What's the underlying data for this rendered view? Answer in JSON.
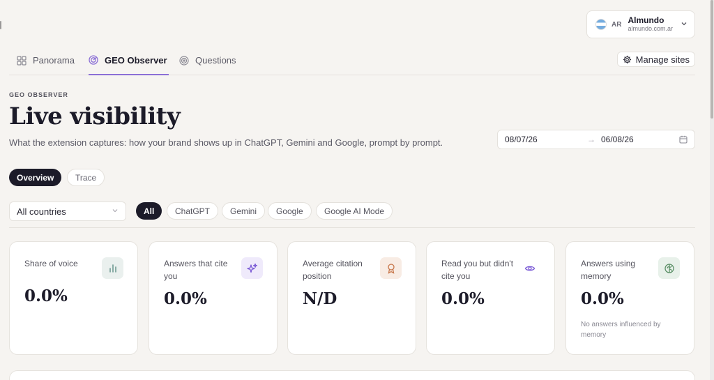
{
  "site": {
    "code": "AR",
    "name": "Almundo",
    "domain": "almundo.com.ar",
    "chevron_icon": "chevron-down-icon"
  },
  "nav": {
    "tabs": [
      {
        "label": "Panorama",
        "icon": "grid-icon",
        "active": false
      },
      {
        "label": "GEO Observer",
        "icon": "radar-icon",
        "active": true
      },
      {
        "label": "Questions",
        "icon": "target-icon",
        "active": false
      }
    ],
    "manage_sites": {
      "label": "Manage sites",
      "icon": "gear-icon"
    }
  },
  "header": {
    "eyebrow": "GEO OBSERVER",
    "title": "Live visibility",
    "subtitle": "What the extension captures: how your brand shows up in ChatGPT, Gemini and Google, prompt by prompt."
  },
  "date_range": {
    "start": "08/07/26",
    "arrow": "→",
    "end": "06/08/26",
    "icon": "calendar-icon"
  },
  "view_toggle": [
    {
      "label": "Overview",
      "active": true
    },
    {
      "label": "Trace",
      "active": false
    }
  ],
  "filters": {
    "country": {
      "value": "All countries"
    },
    "engines": [
      {
        "label": "All",
        "active": true
      },
      {
        "label": "ChatGPT",
        "active": false
      },
      {
        "label": "Gemini",
        "active": false
      },
      {
        "label": "Google",
        "active": false
      },
      {
        "label": "Google AI Mode",
        "active": false
      }
    ]
  },
  "metrics": [
    {
      "label": "Share of voice",
      "value": "0.0%",
      "icon": "bar-chart-icon",
      "icon_bg": "#eaf0ee",
      "icon_color": "#5e8f86"
    },
    {
      "label": "Answers that cite you",
      "value": "0.0%",
      "icon": "sparkles-icon",
      "icon_bg": "#efeafb",
      "icon_color": "#7b5bd6"
    },
    {
      "label": "Average citation position",
      "value": "N/D",
      "icon": "award-icon",
      "icon_bg": "#f8ece4",
      "icon_color": "#c7764a"
    },
    {
      "label": "Read you but didn't cite you",
      "value": "0.0%",
      "icon": "eye-icon",
      "icon_bg": "#ffffff",
      "icon_color": "#7b5bd6"
    },
    {
      "label": "Answers using memory",
      "value": "0.0%",
      "icon": "brain-icon",
      "icon_bg": "#e8f1ea",
      "icon_color": "#5a8f66",
      "note": "No answers influenced by memory"
    }
  ],
  "colors": {
    "accent": "#8b6fd6",
    "ink": "#1c1b29",
    "background": "#f6f4f1"
  }
}
